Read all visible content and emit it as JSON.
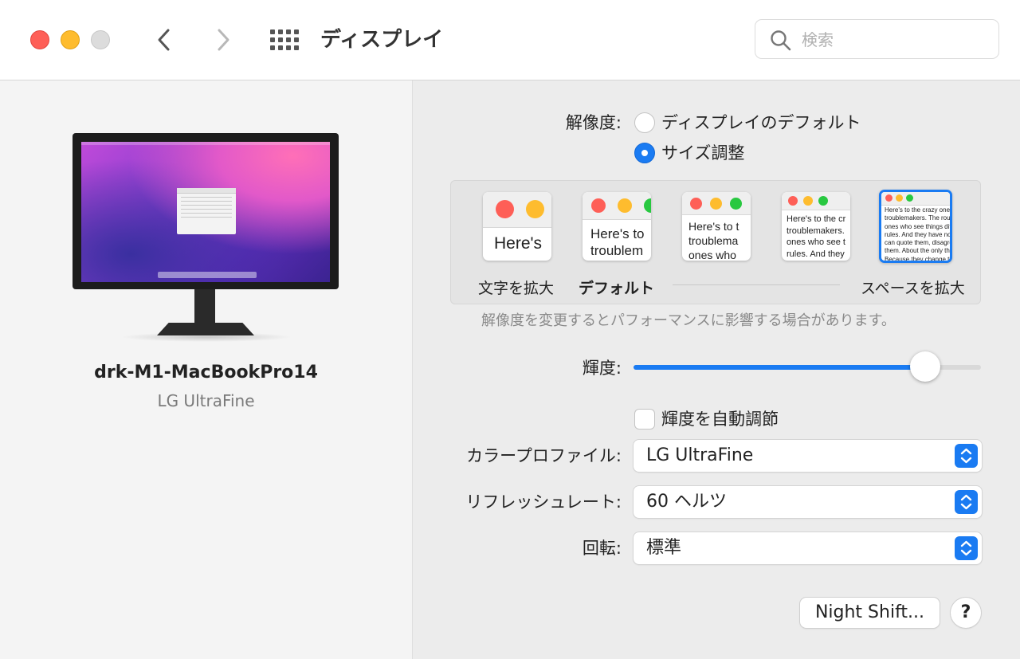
{
  "window": {
    "title": "ディスプレイ",
    "search_placeholder": "検索"
  },
  "device": {
    "name": "drk-M1-MacBookPro14",
    "model": "LG UltraFine"
  },
  "resolution": {
    "label": "解像度:",
    "options": [
      {
        "label": "ディスプレイのデフォルト",
        "selected": false
      },
      {
        "label": "サイズ調整",
        "selected": true
      }
    ],
    "thumbnails": [
      {
        "text": "Here's",
        "selected": false
      },
      {
        "text": "Here's to\ntroublem",
        "selected": false
      },
      {
        "text": "Here's to t\ntroublema\nones who",
        "selected": false
      },
      {
        "text": "Here's to the cr\ntroublemakers.\nones who see t\nrules. And they",
        "selected": false
      },
      {
        "text": "Here's to the crazy ones\ntroublemakers. The rou\nones who see things dif\nrules. And they have no\ncan quote them, disagre\nthem. About the only th\nBecause they change th",
        "selected": true
      }
    ],
    "scale_labels": {
      "larger_text": "文字を拡大",
      "default": "デフォルト",
      "more_space": "スペースを拡大"
    },
    "note": "解像度を変更するとパフォーマンスに影響する場合があります。"
  },
  "brightness": {
    "label": "輝度:",
    "value": 0.84,
    "auto_label": "輝度を自動調節",
    "auto_checked": false
  },
  "color_profile": {
    "label": "カラープロファイル:",
    "value": "LG UltraFine"
  },
  "refresh_rate": {
    "label": "リフレッシュレート:",
    "value": "60 ヘルツ"
  },
  "rotation": {
    "label": "回転:",
    "value": "標準"
  },
  "buttons": {
    "night_shift": "Night Shift...",
    "help": "?"
  },
  "colors": {
    "accent": "#1a7bf2",
    "close": "#fe5f57",
    "minimize": "#febc2e"
  }
}
